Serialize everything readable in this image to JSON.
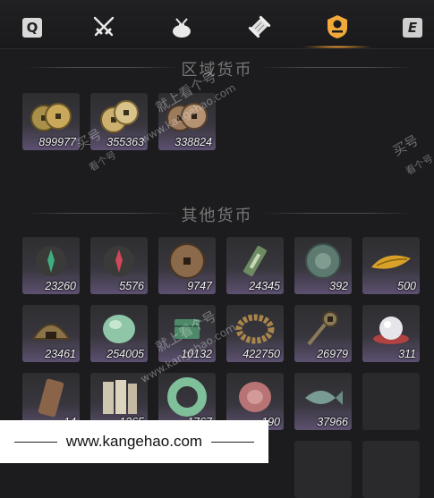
{
  "header": {
    "left_key": "Q",
    "right_key": "E",
    "tabs": [
      {
        "icon": "crossed-swords-icon"
      },
      {
        "icon": "bundle-icon"
      },
      {
        "icon": "scroll-icon"
      },
      {
        "icon": "coin-stack-icon",
        "active": true
      }
    ],
    "accent_color": "#ffb13b"
  },
  "sections": [
    {
      "title": "区域货币",
      "items": [
        {
          "icon": "copper-coins-gold-icon",
          "qty": "899977"
        },
        {
          "icon": "copper-coins-mixed-icon",
          "qty": "355363"
        },
        {
          "icon": "copper-coins-bronze-icon",
          "qty": "338824"
        }
      ]
    },
    {
      "title": "其他货币",
      "items": [
        {
          "icon": "green-talisman-icon",
          "qty": "23260"
        },
        {
          "icon": "red-talisman-icon",
          "qty": "5576"
        },
        {
          "icon": "square-hole-coin-icon",
          "qty": "9747"
        },
        {
          "icon": "jade-token-icon",
          "qty": "24345"
        },
        {
          "icon": "jade-medallion-icon",
          "qty": "392"
        },
        {
          "icon": "gold-feather-icon",
          "qty": "500"
        },
        {
          "icon": "bronze-dome-icon",
          "qty": "23461"
        },
        {
          "icon": "jade-stone-icon",
          "qty": "254005"
        },
        {
          "icon": "green-box-icon",
          "qty": "10132"
        },
        {
          "icon": "bead-ring-icon",
          "qty": "422750"
        },
        {
          "icon": "key-coin-icon",
          "qty": "26979"
        },
        {
          "icon": "pearl-icon",
          "qty": "311"
        },
        {
          "icon": "bronze-tag-icon",
          "qty": "14"
        },
        {
          "icon": "paper-slips-icon",
          "qty": "1365"
        },
        {
          "icon": "jade-ring-icon",
          "qty": "1767"
        },
        {
          "icon": "rose-stone-icon",
          "qty": "190"
        },
        {
          "icon": "jade-fish-icon",
          "qty": "37966"
        },
        {
          "icon": "empty-slot",
          "qty": ""
        }
      ]
    }
  ],
  "watermarks": [
    "就上看个号",
    "www.kangehao.com",
    "买号",
    "看个号",
    "就上看个号",
    "www.kangehao.com",
    "买号",
    "看个号"
  ],
  "banner": {
    "text": "www.kangehao.com"
  }
}
